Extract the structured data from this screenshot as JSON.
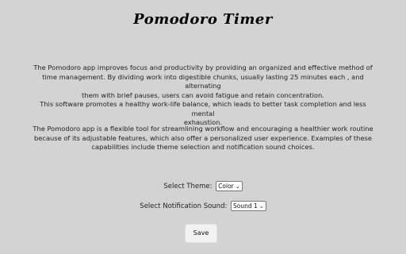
{
  "header": {
    "title": "Pomodoro Timer"
  },
  "description": {
    "p1_lines": [
      "The Pomodoro app improves focus and productivity by providing an organized and effective method of",
      "time management. By dividing work into digestible chunks, usually lasting 25 minutes each , and alternating",
      "them with brief pauses, users can avoid fatigue and retain concentration.",
      "This software promotes a healthy work-life balance, which leads to better task completion and less mental",
      "exhaustion."
    ],
    "p2_lines": [
      "The Pomodoro app is a flexible tool for streamlining workflow and encouraging a healthier work routine",
      "because of its adjustable features, which also offer a personalized user experience. Examples of these",
      "capabilities include theme selection and notification sound choices."
    ]
  },
  "settings": {
    "theme_label": "Select Theme:",
    "theme_value": "Color",
    "sound_label": "Select Notification Sound:",
    "sound_value": "Sound 1"
  },
  "actions": {
    "save_label": "Save"
  },
  "icons": {
    "dropdown": "chevron-down-icon"
  },
  "colors": {
    "background": "#d3d3d3",
    "button": "#f2f2f2"
  }
}
